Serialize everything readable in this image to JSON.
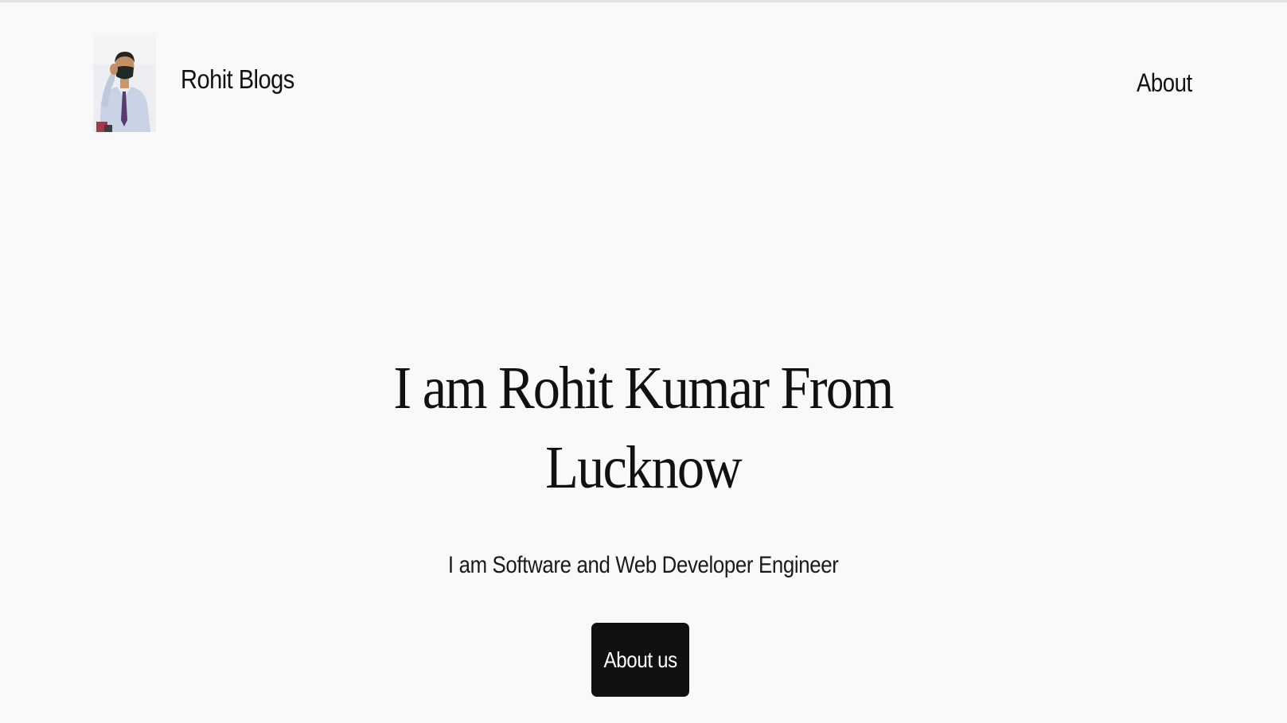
{
  "header": {
    "site_title": "Rohit Blogs",
    "logo_icon": "profile-photo",
    "nav": [
      {
        "label": "About"
      }
    ]
  },
  "hero": {
    "heading_lines": [
      "I am Rohit Kumar From",
      "Lucknow"
    ],
    "subheading": "I am Software and Web Developer Engineer",
    "button_label": "About us"
  },
  "colors": {
    "background": "#f9f9f9",
    "text": "#111111",
    "button_bg": "#111111",
    "button_text": "#ffffff"
  }
}
